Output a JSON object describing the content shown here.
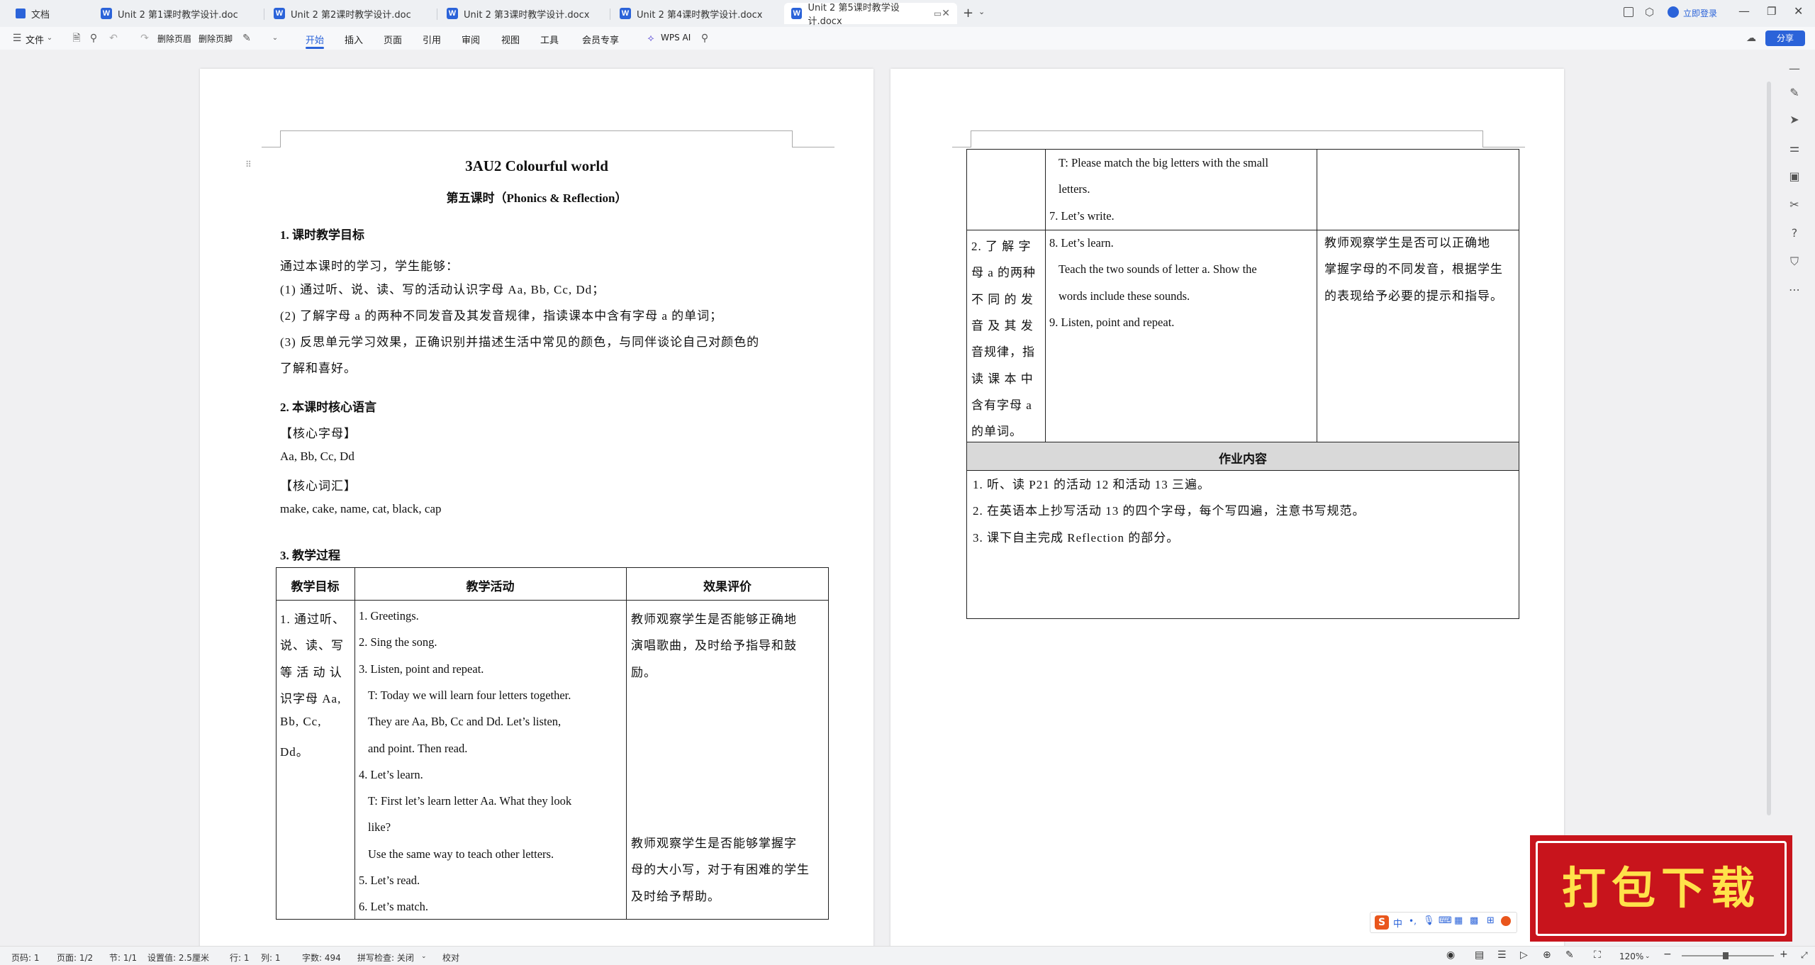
{
  "tabs": [
    {
      "label": "文档"
    },
    {
      "label": "Unit 2 第1课时教学设计.doc"
    },
    {
      "label": "Unit 2 第2课时教学设计.doc"
    },
    {
      "label": "Unit 2 第3课时教学设计.docx"
    },
    {
      "label": "Unit 2 第4课时教学设计.docx"
    },
    {
      "label": "Unit 2 第5课时教学设计.docx"
    }
  ],
  "titlebar": {
    "login": "立即登录",
    "share": "分享"
  },
  "menubar": {
    "file": "文件",
    "del_header": "删除页眉",
    "del_footer": "删除页脚",
    "items": [
      "开始",
      "插入",
      "页面",
      "引用",
      "审阅",
      "视图",
      "工具",
      "会员专享"
    ],
    "wps_ai": "WPS AI"
  },
  "doc": {
    "title": "3AU2 Colourful world",
    "subtitle": "第五课时（Phonics & Reflection）",
    "s1": "1. 课时教学目标",
    "intro": "通过本课时的学习，学生能够：",
    "goal1": "(1)  通过听、说、读、写的活动认识字母 Aa, Bb, Cc, Dd；",
    "goal2": "(2)  了解字母 a 的两种不同发音及其发音规律，指读课本中含有字母 a 的单词；",
    "goal3a": "(3)  反思单元学习效果，正确识别并描述生活中常见的颜色，与同伴谈论自己对颜色的",
    "goal3b": "了解和喜好。",
    "s2": "2. 本课时核心语言",
    "core_letters_label": "【核心字母】",
    "core_letters": "Aa, Bb, Cc, Dd",
    "core_words_label": "【核心词汇】",
    "core_words": "make, cake, name, cat, black, cap",
    "s3": "3. 教学过程",
    "table_headers": [
      "教学目标",
      "教学活动",
      "效果评价"
    ],
    "row1_goal": [
      "1. 通过听、",
      "说、读、写",
      "等 活 动 认",
      "识字母 Aa,",
      "Bb,         Cc,",
      "Dd。"
    ],
    "row1_activities": [
      "1. Greetings.",
      "2. Sing the song.",
      "3. Listen, point and repeat.",
      "   T: Today we will learn four letters together.",
      "   They are Aa, Bb, Cc and Dd. Let’s listen,",
      "   and point. Then read.",
      "4. Let’s learn.",
      "   T: First let’s learn letter Aa. What they look",
      "   like?",
      "   Use the same way to teach other letters.",
      "5. Let’s read.",
      "6. Let’s match."
    ],
    "row1_eval_a": [
      "教师观察学生是否能够正确地",
      "演唱歌曲，及时给予指导和鼓",
      "励。"
    ],
    "row1_eval_b": [
      "教师观察学生是否能够掌握字",
      "母的大小写，对于有困难的学生",
      "及时给予帮助。"
    ]
  },
  "doc2": {
    "cont_activities": [
      "T: Please match the big letters with the small",
      "letters.",
      "7. Let’s write."
    ],
    "row2_goal": [
      "2.  了 解 字",
      "母 a 的两种",
      "不 同 的 发",
      "音 及 其 发",
      "音规律，指",
      "读 课 本 中",
      "含有字母 a",
      "的单词。"
    ],
    "row2_activities": [
      "8. Let’s learn.",
      "Teach  the  two  sounds  of  letter  a.  Show  the",
      "words include these sounds.",
      "9. Listen, point and repeat."
    ],
    "row2_eval": [
      "教师观察学生是否可以正确地",
      "掌握字母的不同发音，根据学生",
      "的表现给予必要的提示和指导。"
    ],
    "hw_header": "作业内容",
    "homework": [
      "1.  听、读 P21 的活动 12 和活动 13 三遍。",
      "2.  在英语本上抄写活动 13 的四个字母，每个写四遍，注意书写规范。",
      "3.  课下自主完成 Reflection 的部分。"
    ]
  },
  "statusbar": {
    "page_code": "页码: 1",
    "pages": "页面: 1/2",
    "section": "节: 1/1",
    "setting": "设置值: 2.5厘米",
    "row": "行: 1",
    "col": "列: 1",
    "words": "字数: 494",
    "spell": "拼写检查: 关闭",
    "proof": "校对",
    "zoom": "120%"
  },
  "banner": {
    "text": "打包下载"
  },
  "ime": {
    "label": "中"
  }
}
